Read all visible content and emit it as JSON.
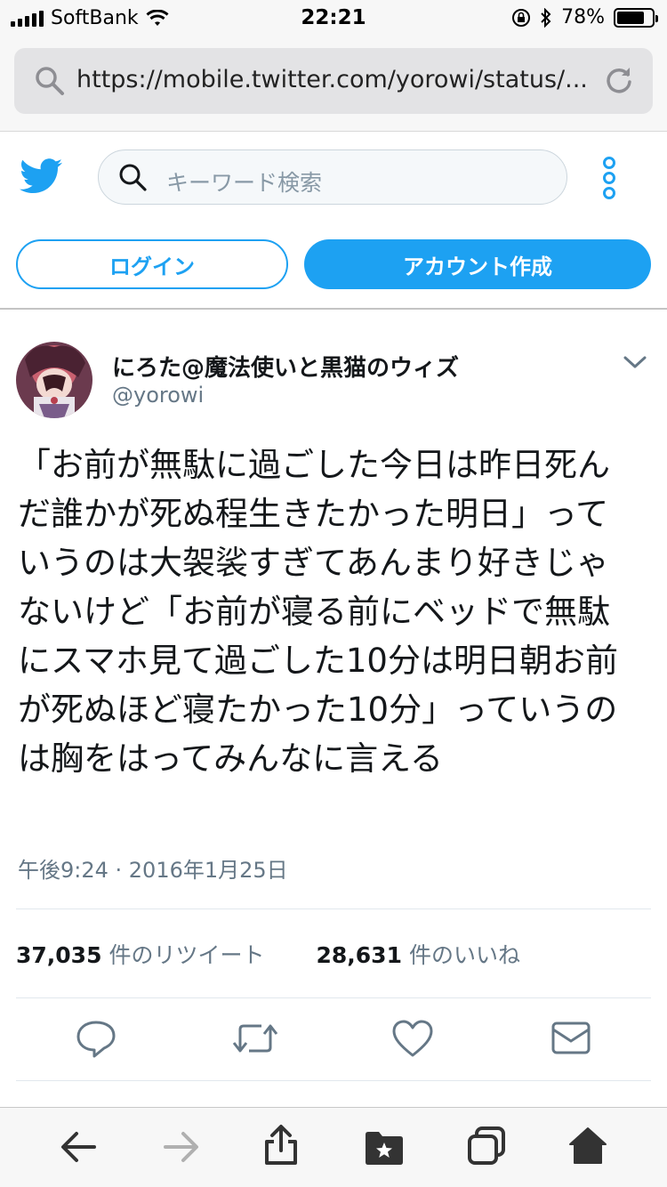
{
  "status_bar": {
    "carrier": "SoftBank",
    "time": "22:21",
    "battery_percent": "78%",
    "battery_level": 0.78,
    "icons": [
      "signal-bars-icon",
      "wifi-icon",
      "orientation-lock-icon",
      "bluetooth-icon",
      "battery-icon"
    ]
  },
  "browser": {
    "url": "https://mobile.twitter.com/yorowi/status/...",
    "icons": [
      "search-icon",
      "reload-icon"
    ]
  },
  "twitter_header": {
    "search_placeholder": "キーワード検索",
    "icons": [
      "twitter-bird-icon",
      "search-icon",
      "more-vertical-icon"
    ]
  },
  "auth": {
    "login_label": "ログイン",
    "signup_label": "アカウント作成"
  },
  "tweet": {
    "author_name": "にろた@魔法使いと黒猫のウィズ",
    "author_handle": "@yorowi",
    "text": "「お前が無駄に過ごした今日は昨日死んだ誰かが死ぬ程生きたかった明日」っていうのは大袈裟すぎてあんまり好きじゃないけど「お前が寝る前にベッドで無駄にスマホ見て過ごした10分は明日朝お前が死ぬほど寝たかった10分」っていうのは胸をはってみんなに言える",
    "timestamp": "午後9:24 · 2016年1月25日",
    "retweet_count": "37,035",
    "retweet_label": "件のリツイート",
    "like_count": "28,631",
    "like_label": "件のいいね"
  },
  "tweet_actions": [
    "reply-icon",
    "retweet-icon",
    "like-heart-icon",
    "direct-message-icon"
  ],
  "toolbar_icons": [
    "back-arrow-icon",
    "forward-arrow-icon",
    "share-icon",
    "bookmarks-icon",
    "tabs-icon",
    "home-icon"
  ],
  "colors": {
    "twitter_blue": "#1da1f2",
    "secondary_text": "#657786",
    "primary_text": "#14171a"
  }
}
